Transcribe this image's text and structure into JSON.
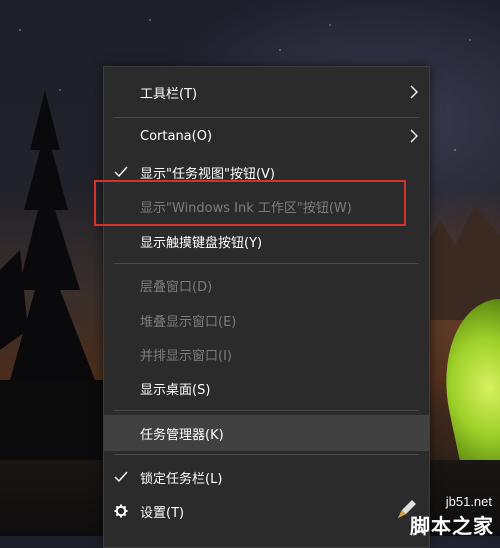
{
  "menu": {
    "items": [
      {
        "label": "工具栏(T)",
        "submenu": true
      },
      {
        "label": "Cortana(O)",
        "submenu": true
      },
      {
        "label": "显示\"任务视图\"按钮(V)",
        "checked": true
      },
      {
        "label": "显示\"Windows Ink 工作区\"按钮(W)",
        "disabled": true
      },
      {
        "label": "显示触摸键盘按钮(Y)"
      },
      {
        "label": "层叠窗口(D)",
        "disabled": true
      },
      {
        "label": "堆叠显示窗口(E)",
        "disabled": true
      },
      {
        "label": "并排显示窗口(I)",
        "disabled": true
      },
      {
        "label": "显示桌面(S)"
      },
      {
        "label": "任务管理器(K)",
        "highlighted": true
      },
      {
        "label": "锁定任务栏(L)",
        "checked": true
      },
      {
        "label": "设置(T)",
        "icon": "gear-icon"
      }
    ]
  },
  "watermark": {
    "url": "jb51.net",
    "name": "脚本之家"
  },
  "colors": {
    "menu_bg": "#2b2b2b",
    "highlight_bg": "#414141",
    "disabled_text": "#7c7c7c",
    "annotation_red": "#d8302a",
    "tent_green": "#9ed12a"
  }
}
